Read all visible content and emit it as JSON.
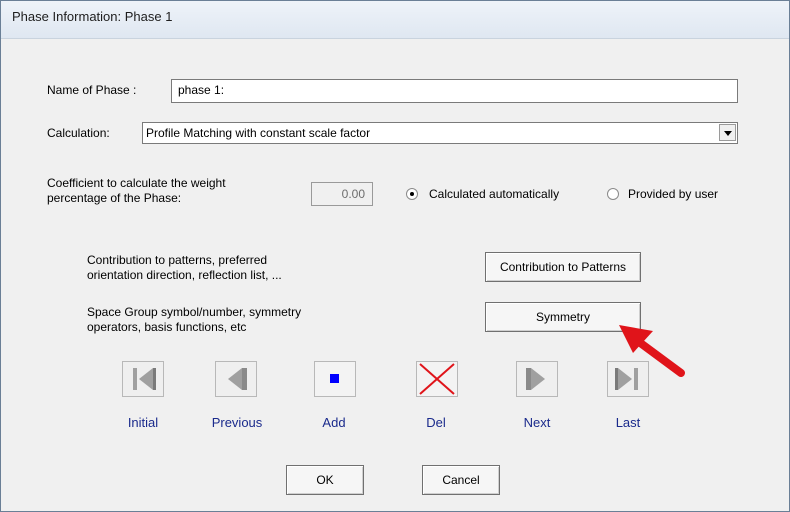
{
  "window": {
    "title": "Phase Information: Phase 1"
  },
  "form": {
    "name_label": "Name of Phase :",
    "name_value": "phase 1:",
    "calc_label": "Calculation:",
    "calc_value": "Profile Matching with constant scale factor",
    "coef_label_line1": "Coefficient to calculate the weight",
    "coef_label_line2": "percentage of the Phase:",
    "coef_value": "0.00",
    "radio_auto": "Calculated automatically",
    "radio_user": "Provided by user",
    "radio_selected": "auto"
  },
  "sections": {
    "contrib_line1": "Contribution to patterns, preferred",
    "contrib_line2": "orientation direction, reflection list, ...",
    "contrib_button": "Contribution to Patterns",
    "symm_line1": "Space Group symbol/number, symmetry",
    "symm_line2": "operators, basis functions, etc",
    "symm_button": "Symmetry"
  },
  "nav": {
    "initial": "Initial",
    "previous": "Previous",
    "add": "Add",
    "del": "Del",
    "next": "Next",
    "last": "Last"
  },
  "footer": {
    "ok": "OK",
    "cancel": "Cancel"
  },
  "icons": {
    "initial": "first-record-icon",
    "previous": "previous-record-icon",
    "add": "add-record-icon",
    "del": "delete-record-icon",
    "next": "next-record-icon",
    "last": "last-record-icon",
    "annotation": "red-arrow-icon"
  },
  "colors": {
    "nav_label": "#1a2a8c",
    "arrow": "#e0141a",
    "add_square": "#0000ff",
    "del_x": "#e0141a"
  }
}
